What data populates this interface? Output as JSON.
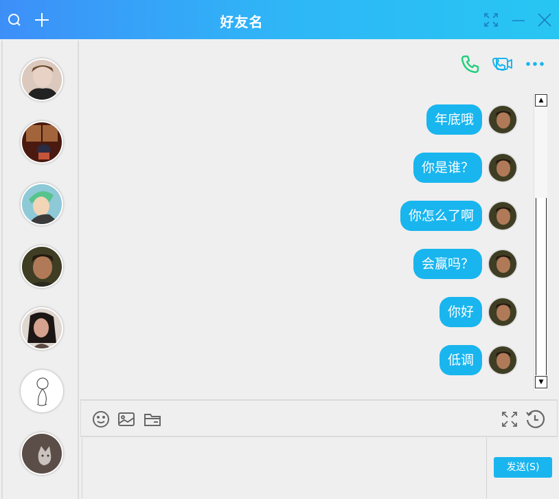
{
  "window": {
    "title": "好友名",
    "icons": [
      "search-icon",
      "plus-icon",
      "maximize-icon",
      "minimize-icon",
      "close-icon"
    ]
  },
  "sidebar": {
    "contacts": [
      {
        "name": "contact-1",
        "avatar_colors": [
          "#2b2b2b",
          "#e8d2c6"
        ]
      },
      {
        "name": "contact-2",
        "avatar_colors": [
          "#4a1a10",
          "#c4553b"
        ]
      },
      {
        "name": "contact-3",
        "avatar_colors": [
          "#6fb7c9",
          "#57c38d"
        ]
      },
      {
        "name": "contact-4",
        "avatar_colors": [
          "#3f3d23",
          "#b07a58"
        ]
      },
      {
        "name": "contact-5",
        "avatar_colors": [
          "#1c1614",
          "#d4a28e"
        ]
      },
      {
        "name": "contact-6",
        "avatar_colors": [
          "#ffffff",
          "#333333"
        ]
      },
      {
        "name": "contact-7",
        "avatar_colors": [
          "#5b4d47",
          "#c9c2bd"
        ]
      }
    ]
  },
  "header_actions": {
    "icons": [
      "phone-icon",
      "video-call-icon",
      "more-icon"
    ],
    "colors": {
      "phone": "#1fcf7a",
      "video": "#19b5ee",
      "more": "#19b5ee"
    }
  },
  "messages": [
    {
      "text": "年底哦"
    },
    {
      "text": "你是谁？"
    },
    {
      "text": "你怎么了啊"
    },
    {
      "text": "会赢吗？"
    },
    {
      "text": "你好"
    },
    {
      "text": "低调"
    }
  ],
  "toolbar": {
    "icons": [
      "emoji-icon",
      "image-icon",
      "folder-icon",
      "expand-icon",
      "history-icon"
    ]
  },
  "input": {
    "value": ""
  },
  "send_button": {
    "label": "发送(S)"
  },
  "colors": {
    "accent": "#19b5ee",
    "titlebar_start": "#3d8ff8",
    "titlebar_end": "#27c6f2"
  }
}
